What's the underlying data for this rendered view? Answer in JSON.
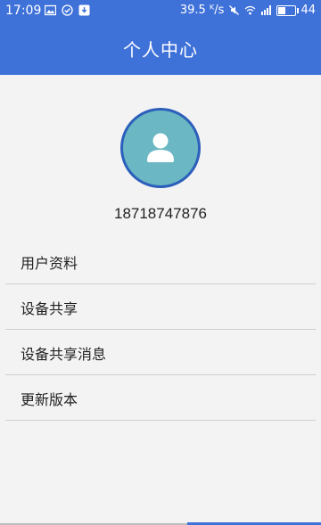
{
  "status_bar": {
    "time": "17:09",
    "speed": "39.5 ᴷ/s",
    "battery": "44",
    "battery_level": 0.44,
    "left_icons": [
      "image-icon",
      "check-circle-icon",
      "download-icon"
    ],
    "right_icons": [
      "mute-icon",
      "wifi-icon",
      "signal-icon",
      "battery-icon"
    ]
  },
  "header": {
    "title": "个人中心",
    "bg_color": "#3f72d9"
  },
  "profile": {
    "avatar_icon": "user-avatar-icon",
    "avatar_color": "#6bb7c3",
    "phone": "18718747876"
  },
  "menu": {
    "items": [
      {
        "label": "用户资料"
      },
      {
        "label": "设备共享"
      },
      {
        "label": "设备共享消息"
      },
      {
        "label": "更新版本"
      }
    ]
  }
}
